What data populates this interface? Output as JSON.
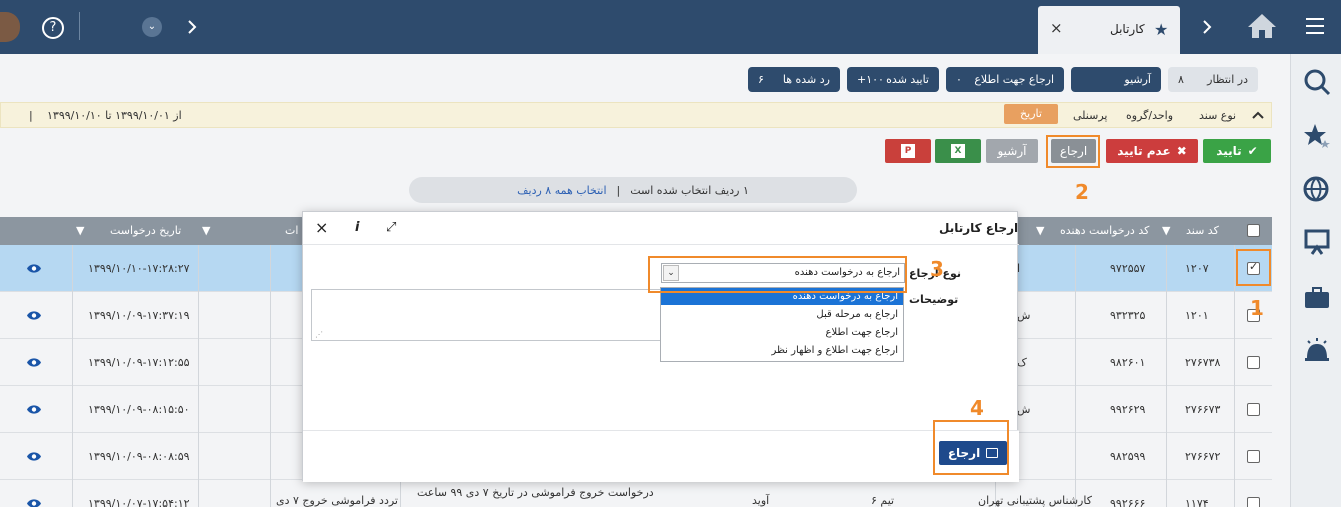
{
  "header": {
    "tab_title": "کارتابل",
    "tab_close": "×",
    "help_icon": "?"
  },
  "tabs": [
    {
      "label": "در انتظار",
      "count": "۸"
    },
    {
      "label": "آرشیو",
      "count": ""
    },
    {
      "label": "ارجاع جهت اطلاع",
      "count": "۰"
    },
    {
      "label": "تایید شده",
      "count": "۱۰۰+"
    },
    {
      "label": "رد شده ها",
      "count": "۶"
    }
  ],
  "filters": {
    "doc_type": "نوع سند",
    "unit_group": "واحد/گروه",
    "personnel": "پرسنلی",
    "date": "تاریخ",
    "date_range": "از ۱۳۹۹/۱۰/۰۱   تا ۱۳۹۹/۱۰/۱۰",
    "separator": "|"
  },
  "actions": {
    "approve": "تایید",
    "reject": "عدم تایید",
    "refer": "ارجاع",
    "archive": "آرشیو"
  },
  "selection": {
    "count_text": "۱ ردیف انتخاب شده است",
    "separator": "|",
    "select_all": "انتخاب همه ۸ ردیف"
  },
  "grid": {
    "headers": {
      "doc_code": "کد سند",
      "request_code": "کد درخواست دهنده",
      "request_date": "تاریخ درخواست",
      "notes_partial": "ات"
    },
    "rows": [
      {
        "doc": "۱۲۰۷",
        "req_code": "۹۷۲۵۵۷",
        "date": "۱۳۹۹/۱۰/۱۰-۱۷:۲۸:۲۷",
        "letter": "ا",
        "selected": true
      },
      {
        "doc": "۱۲۰۱",
        "req_code": "۹۳۲۳۲۵",
        "date": "۱۳۹۹/۱۰/۰۹-۱۷:۳۷:۱۹",
        "letter": "ش",
        "selected": false
      },
      {
        "doc": "۲۷۶۷۳۸",
        "req_code": "۹۸۲۶۰۱",
        "date": "۱۳۹۹/۱۰/۰۹-۱۷:۱۲:۵۵",
        "letter": "ک",
        "selected": false
      },
      {
        "doc": "۲۷۶۶۷۳",
        "req_code": "۹۹۲۶۲۹",
        "date": "۱۳۹۹/۱۰/۰۹-۰۸:۱۵:۵۰",
        "letter": "ش",
        "selected": false
      },
      {
        "doc": "۲۷۶۶۷۲",
        "req_code": "۹۸۲۵۹۹",
        "date": "۱۳۹۹/۱۰/۰۹-۰۸:۰۸:۵۹",
        "letter": "",
        "selected": false
      },
      {
        "doc": "۱۱۷۴",
        "req_code": "۹۹۲۶۶۶",
        "date": "۱۳۹۹/۱۰/۰۷-۱۷:۵۴:۱۲",
        "letter": "",
        "selected": false,
        "role": "کارشناس پشتیبانی تهران",
        "team": "تیم ۶",
        "name": "آوید",
        "desc": "درخواست خروج فراموشی در تاریخ ۷ دی ۹۹ ساعت",
        "note": "تردد فراموشی خروج ۷ دی"
      }
    ]
  },
  "modal": {
    "title": "ارجاع کارتابل",
    "close": "×",
    "info": "i",
    "expand": "⤢",
    "refer_type_label": "نوع ارجاع",
    "refer_type_value": "ارجاع به درخواست دهنده",
    "description_label": "توضیحات",
    "options": [
      "ارجاع به درخواست دهنده",
      "ارجاع به مرحله قبل",
      "ارجاع جهت اطلاع",
      "ارجاع جهت اطلاع و اظهار نظر"
    ],
    "submit": "ارجاع"
  },
  "annotations": [
    "1",
    "2",
    "3",
    "4"
  ],
  "colors": {
    "header_bg": "#2e4b6d",
    "approve": "#3aa346",
    "reject": "#cc3d3d",
    "refer_gray": "#8a9096",
    "excel_green": "#3a8f4a",
    "pdf_red": "#c9403b",
    "highlight": "#f08a2b",
    "selected_row": "#b6d8f2",
    "submit_blue": "#1e4a8c"
  }
}
